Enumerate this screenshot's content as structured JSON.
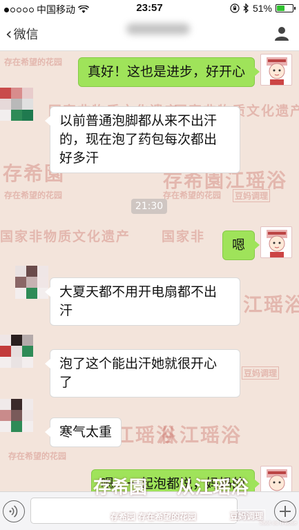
{
  "status_bar": {
    "carrier": "中国移动",
    "time": "23:57",
    "battery_percent": "51%",
    "battery_level": 0.51,
    "signal_bars_filled": 1,
    "signal_bars_total": 5
  },
  "nav": {
    "back_label": "微信",
    "back_icon": "chevron-left-icon",
    "profile_icon": "person-icon"
  },
  "watermarks": {
    "shop_slogan": "存在希望的花园",
    "brand_box": "豆妈调理",
    "heritage": "国家非物质文化遗产",
    "heritage_partial_left": "国家非物质文化遗产",
    "heritage_partial_right": "国家非",
    "shop_logo": "存希園",
    "yao_bath": "从江瑶浴",
    "yao_bath_short": "江瑶浴"
  },
  "messages": [
    {
      "sender": "me",
      "text": "真好！这也是进步，好开心"
    },
    {
      "sender": "other",
      "lines": [
        "以前普通泡脚都从来不出汗",
        "的，现在泡了药包每次都出",
        "好多汗"
      ]
    },
    {
      "type": "timestamp",
      "text": "21:30"
    },
    {
      "sender": "me",
      "text": "嗯"
    },
    {
      "sender": "other",
      "lines": [
        "大夏天都不用开电扇都不出",
        "汗"
      ]
    },
    {
      "sender": "other",
      "lines": [
        "泡了这个能出汗她就很开心",
        "了"
      ]
    },
    {
      "sender": "other",
      "text": "寒气太重"
    },
    {
      "sender": "me",
      "text": "嗯。一起泡都说，妈妈的"
    }
  ],
  "overlay": {
    "logo": "存希園",
    "name": "从江瑶浴",
    "slogan": "存希园 存在希望的花园",
    "brand_box": "豆妈调理",
    "credit": "Shot on iPhone"
  },
  "colors": {
    "my_bubble": "#9fe35a",
    "other_bubble": "#ffffff",
    "watermark_red": "#c45b52",
    "battery_green": "#2fc12f"
  }
}
